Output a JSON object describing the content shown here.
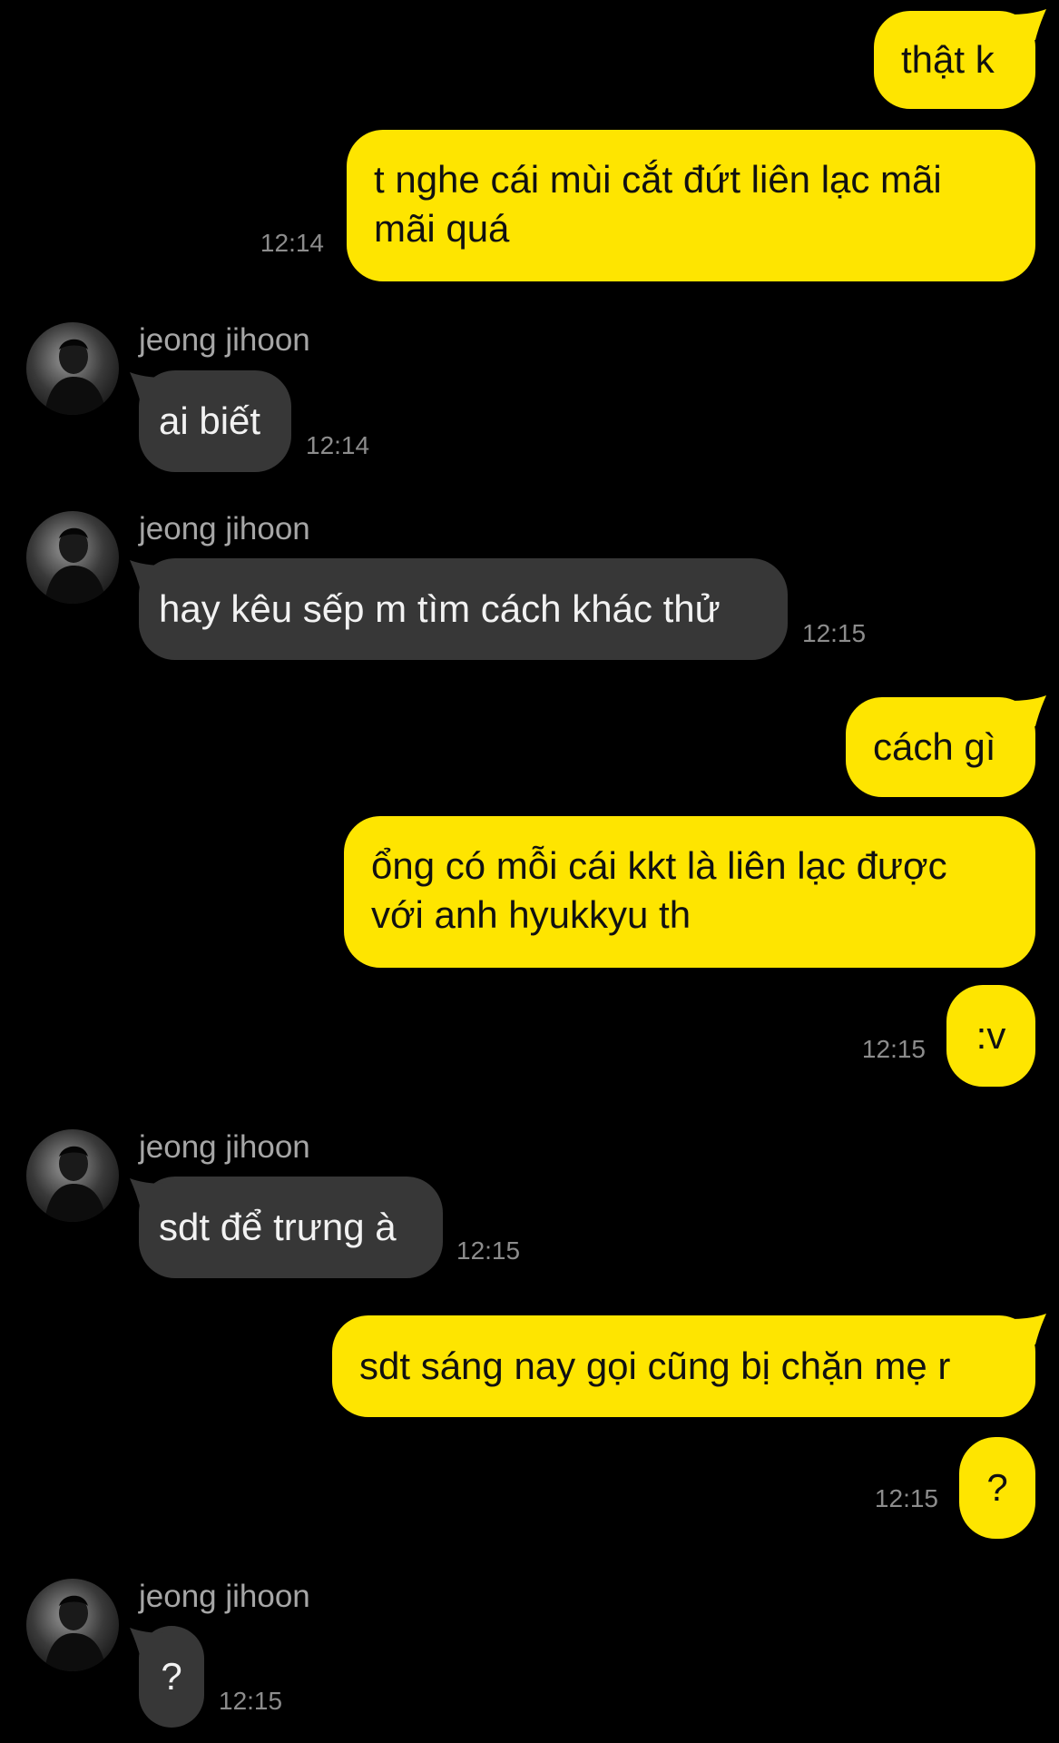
{
  "theme": {
    "outgoing_bubble": "#fee500",
    "incoming_bubble": "#373737",
    "background": "#000000"
  },
  "contact": {
    "name": "jeong jihoon",
    "avatar_icon": "profile-photo-icon"
  },
  "messages": [
    {
      "dir": "out",
      "text": "thật k"
    },
    {
      "dir": "out",
      "text": "t nghe cái mùi cắt đứt liên lạc mãi\nmãi quá",
      "time": "12:14"
    },
    {
      "dir": "in",
      "sender": "jeong jihoon",
      "text": "ai biết",
      "time": "12:14"
    },
    {
      "dir": "in",
      "sender": "jeong jihoon",
      "text": "hay kêu sếp m tìm cách khác thử",
      "time": "12:15"
    },
    {
      "dir": "out",
      "text": "cách gì"
    },
    {
      "dir": "out",
      "text": "ổng có mỗi cái kkt là liên lạc được\nvới anh hyukkyu th"
    },
    {
      "dir": "out",
      "text": ":v",
      "time": "12:15"
    },
    {
      "dir": "in",
      "sender": "jeong jihoon",
      "text": "sdt để trưng à",
      "time": "12:15"
    },
    {
      "dir": "out",
      "text": "sdt sáng nay gọi cũng bị chặn mẹ r"
    },
    {
      "dir": "out",
      "text": "?",
      "time": "12:15"
    },
    {
      "dir": "in",
      "sender": "jeong jihoon",
      "text": "?",
      "time": "12:15"
    }
  ]
}
